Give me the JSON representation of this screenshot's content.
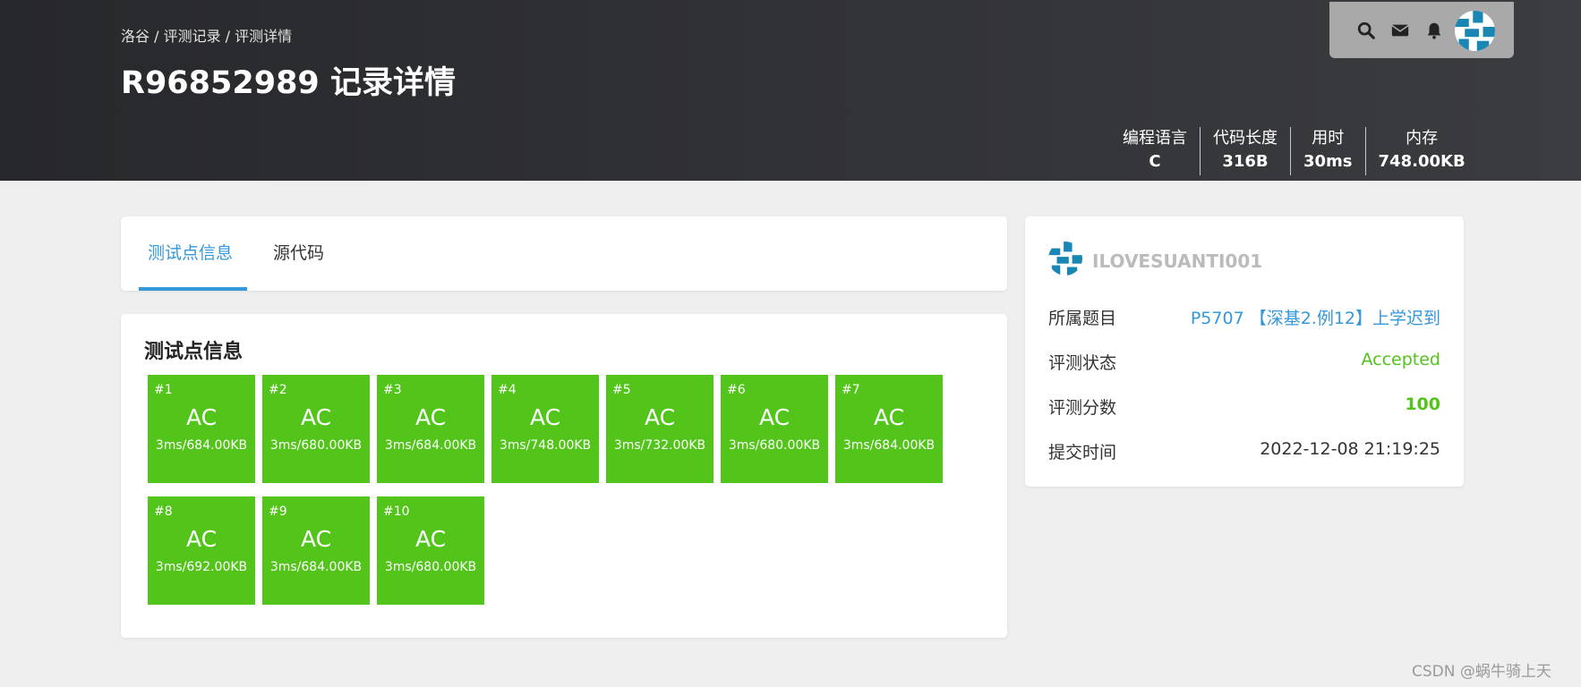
{
  "header": {
    "breadcrumb": "洛谷 / 评测记录 / 评测详情",
    "title": "R96852989 记录详情"
  },
  "nav": {
    "icons": [
      "search-icon",
      "mail-icon",
      "bell-icon"
    ]
  },
  "stats": [
    {
      "label": "编程语言",
      "value": "C"
    },
    {
      "label": "代码长度",
      "value": "316B"
    },
    {
      "label": "用时",
      "value": "30ms"
    },
    {
      "label": "内存",
      "value": "748.00KB"
    }
  ],
  "tabs": {
    "testcases": "测试点信息",
    "source": "源代码"
  },
  "testcases": {
    "title": "测试点信息",
    "cases": [
      {
        "num": "#1",
        "status": "AC",
        "detail": "3ms/684.00KB"
      },
      {
        "num": "#2",
        "status": "AC",
        "detail": "3ms/680.00KB"
      },
      {
        "num": "#3",
        "status": "AC",
        "detail": "3ms/684.00KB"
      },
      {
        "num": "#4",
        "status": "AC",
        "detail": "3ms/748.00KB"
      },
      {
        "num": "#5",
        "status": "AC",
        "detail": "3ms/732.00KB"
      },
      {
        "num": "#6",
        "status": "AC",
        "detail": "3ms/680.00KB"
      },
      {
        "num": "#7",
        "status": "AC",
        "detail": "3ms/684.00KB"
      },
      {
        "num": "#8",
        "status": "AC",
        "detail": "3ms/692.00KB"
      },
      {
        "num": "#9",
        "status": "AC",
        "detail": "3ms/684.00KB"
      },
      {
        "num": "#10",
        "status": "AC",
        "detail": "3ms/680.00KB"
      }
    ]
  },
  "info": {
    "username": "ILOVESUANTI001",
    "problem_label": "所属题目",
    "problem_value": "P5707 【深基2.例12】上学迟到",
    "status_label": "评测状态",
    "status_value": "Accepted",
    "score_label": "评测分数",
    "score_value": "100",
    "time_label": "提交时间",
    "time_value": "2022-12-08 21:19:25"
  },
  "watermark": "CSDN @蜗牛骑上天",
  "colors": {
    "accent": "#3498db",
    "ac_green": "#52c41a",
    "header_dark": "#2c2d30"
  }
}
